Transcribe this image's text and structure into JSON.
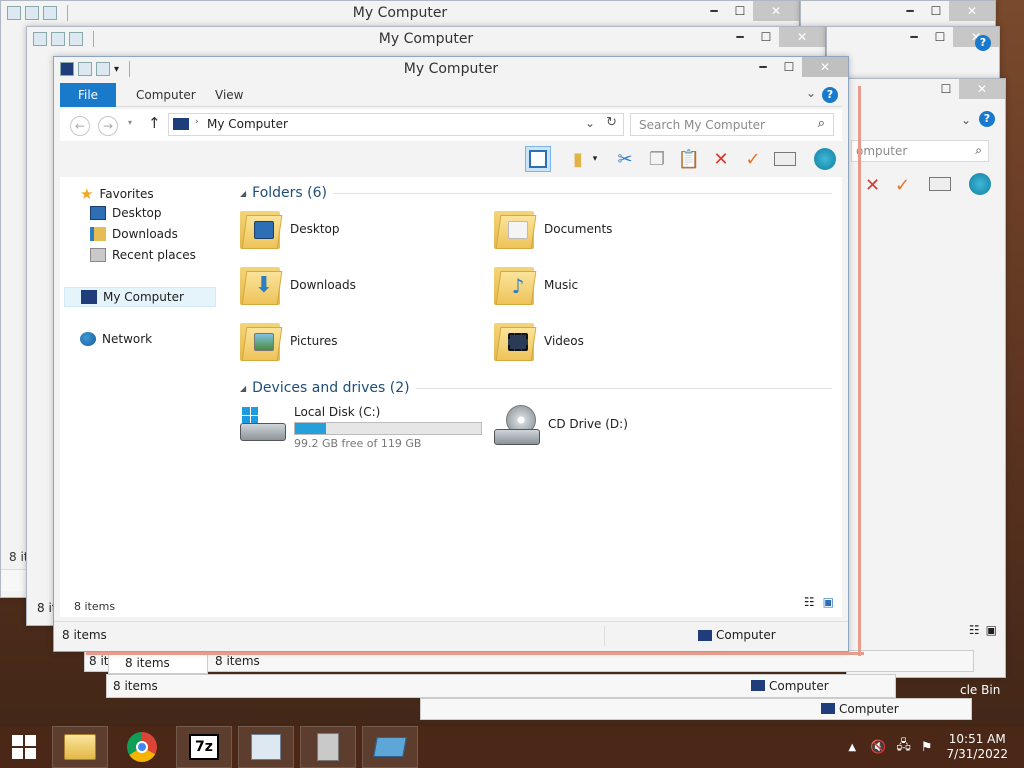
{
  "window_title": "My Computer",
  "ribbon_tabs": [
    "File",
    "Computer",
    "View"
  ],
  "address": "My Computer",
  "search_placeholder": "Search My Computer",
  "back_address_partial": "omputer",
  "nav": {
    "favorites": "Favorites",
    "desktop": "Desktop",
    "downloads": "Downloads",
    "recent": "Recent places",
    "mycomputer": "My Computer",
    "network": "Network"
  },
  "folders_header": "Folders (6)",
  "folders": [
    "Desktop",
    "Documents",
    "Downloads",
    "Music",
    "Pictures",
    "Videos"
  ],
  "devices_header": "Devices and drives (2)",
  "drives": {
    "c_name": "Local Disk (C:)",
    "c_free": "99.2 GB free of 119 GB",
    "c_used_fraction": 0.166,
    "d_name": "CD Drive (D:)"
  },
  "status": {
    "items_inner": "8 items",
    "items": "8 items",
    "computer": "Computer"
  },
  "ghost": {
    "items": "8 items",
    "items_trunc": "8 it",
    "computer": "Computer",
    "recycle": "cle Bin"
  },
  "clock": {
    "time": "10:51 AM",
    "date": "7/31/2022"
  },
  "taskbar_icons": [
    "windows-start-icon",
    "file-explorer-icon",
    "chrome-icon",
    "7zip-icon",
    "resource-monitor-icon",
    "recycle-utility-icon",
    "explorer-window-icon"
  ],
  "colors": {
    "accent": "#1979ca",
    "group": "#1e4e79",
    "progress": "#26a0da"
  }
}
